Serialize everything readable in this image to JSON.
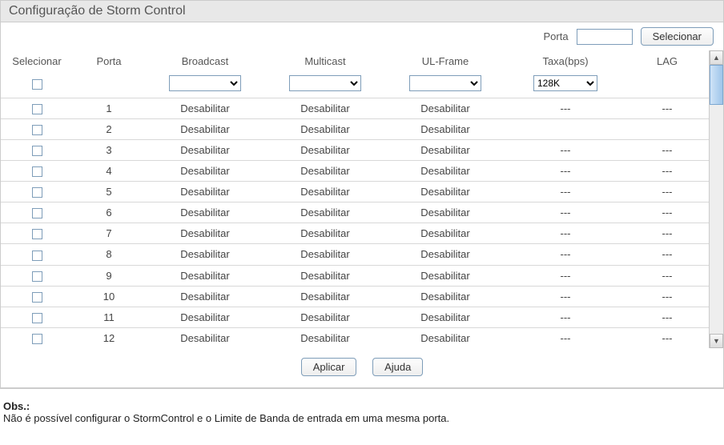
{
  "title": "Configuração de Storm Control",
  "topbar": {
    "port_label": "Porta",
    "select_button": "Selecionar"
  },
  "columns": {
    "select": "Selecionar",
    "port": "Porta",
    "broadcast": "Broadcast",
    "multicast": "Multicast",
    "ulframe": "UL-Frame",
    "rate": "Taxa(bps)",
    "lag": "LAG"
  },
  "filter": {
    "rate_value": "128K"
  },
  "rows": [
    {
      "port": "1",
      "broadcast": "Desabilitar",
      "multicast": "Desabilitar",
      "ulframe": "Desabilitar",
      "rate": "---",
      "lag": "---"
    },
    {
      "port": "2",
      "broadcast": "Desabilitar",
      "multicast": "Desabilitar",
      "ulframe": "Desabilitar",
      "rate": "",
      "lag": ""
    },
    {
      "port": "3",
      "broadcast": "Desabilitar",
      "multicast": "Desabilitar",
      "ulframe": "Desabilitar",
      "rate": "---",
      "lag": "---"
    },
    {
      "port": "4",
      "broadcast": "Desabilitar",
      "multicast": "Desabilitar",
      "ulframe": "Desabilitar",
      "rate": "---",
      "lag": "---"
    },
    {
      "port": "5",
      "broadcast": "Desabilitar",
      "multicast": "Desabilitar",
      "ulframe": "Desabilitar",
      "rate": "---",
      "lag": "---"
    },
    {
      "port": "6",
      "broadcast": "Desabilitar",
      "multicast": "Desabilitar",
      "ulframe": "Desabilitar",
      "rate": "---",
      "lag": "---"
    },
    {
      "port": "7",
      "broadcast": "Desabilitar",
      "multicast": "Desabilitar",
      "ulframe": "Desabilitar",
      "rate": "---",
      "lag": "---"
    },
    {
      "port": "8",
      "broadcast": "Desabilitar",
      "multicast": "Desabilitar",
      "ulframe": "Desabilitar",
      "rate": "---",
      "lag": "---"
    },
    {
      "port": "9",
      "broadcast": "Desabilitar",
      "multicast": "Desabilitar",
      "ulframe": "Desabilitar",
      "rate": "---",
      "lag": "---"
    },
    {
      "port": "10",
      "broadcast": "Desabilitar",
      "multicast": "Desabilitar",
      "ulframe": "Desabilitar",
      "rate": "---",
      "lag": "---"
    },
    {
      "port": "11",
      "broadcast": "Desabilitar",
      "multicast": "Desabilitar",
      "ulframe": "Desabilitar",
      "rate": "---",
      "lag": "---"
    },
    {
      "port": "12",
      "broadcast": "Desabilitar",
      "multicast": "Desabilitar",
      "ulframe": "Desabilitar",
      "rate": "---",
      "lag": "---"
    }
  ],
  "buttons": {
    "apply": "Aplicar",
    "help": "Ajuda"
  },
  "note": {
    "heading": "Obs.:",
    "text": "Não é possível configurar o StormControl e o Limite de Banda de entrada em uma mesma porta."
  }
}
